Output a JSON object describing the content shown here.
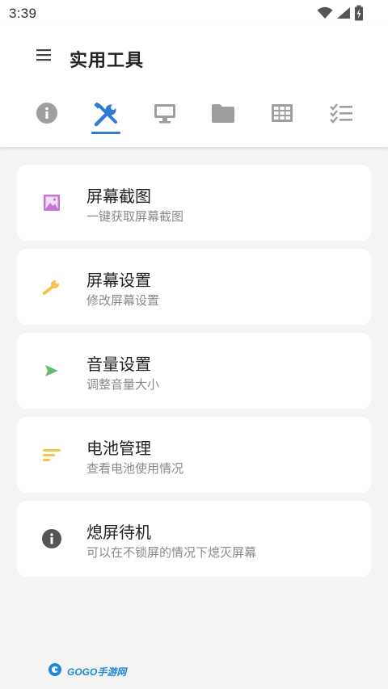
{
  "status_bar": {
    "time": "3:39"
  },
  "header": {
    "title": "实用工具"
  },
  "tabs": [
    {
      "name": "info",
      "icon": "info-icon",
      "active": false
    },
    {
      "name": "tools",
      "icon": "tools-icon",
      "active": true
    },
    {
      "name": "monitor",
      "icon": "monitor-icon",
      "active": false
    },
    {
      "name": "folder",
      "icon": "folder-icon",
      "active": false
    },
    {
      "name": "grid",
      "icon": "grid-icon",
      "active": false
    },
    {
      "name": "checklist",
      "icon": "checklist-icon",
      "active": false
    }
  ],
  "cards": [
    {
      "title": "屏幕截图",
      "subtitle": "一键获取屏幕截图",
      "icon": "image-icon",
      "icon_color": "#c774d6"
    },
    {
      "title": "屏幕设置",
      "subtitle": "修改屏幕设置",
      "icon": "wrench-icon",
      "icon_color": "#f5c24a"
    },
    {
      "title": "音量设置",
      "subtitle": "调整音量大小",
      "icon": "play-icon",
      "icon_color": "#66bb6a"
    },
    {
      "title": "电池管理",
      "subtitle": "查看电池使用情况",
      "icon": "sort-icon",
      "icon_color": "#f5c24a"
    },
    {
      "title": "熄屏待机",
      "subtitle": "可以在不锁屏的情况下熄灭屏幕",
      "icon": "info-circle-icon",
      "icon_color": "#555555"
    }
  ],
  "watermark": {
    "text": "GOGO手游网"
  },
  "colors": {
    "accent": "#2f7bd6",
    "tab_inactive": "#9e9e9e",
    "background": "#f4f4f4"
  }
}
